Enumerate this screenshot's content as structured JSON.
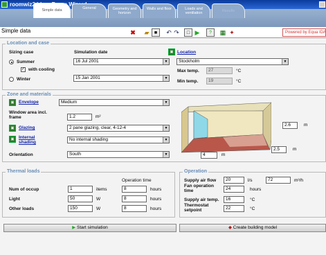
{
  "window": {
    "title": "roomwiz2.idm - Room Wizard"
  },
  "tabs": [
    {
      "label": "Simple data"
    },
    {
      "label": "General"
    },
    {
      "label": "Geometry and horizon"
    },
    {
      "label": "Walls and floor"
    },
    {
      "label": "Loads and ventilation"
    },
    {
      "label": "Results"
    }
  ],
  "toolbar": {
    "page_title": "Simple data",
    "brand": "Powered by Equa IDA"
  },
  "location": {
    "legend": "Location and case",
    "sizing_case_label": "Sizing case",
    "simulation_date_label": "Simulation date",
    "summer_label": "Summer",
    "summer_date": "16 Jul 2001",
    "with_cooling_label": "with cooling",
    "winter_label": "Winter",
    "winter_date": "15 Jan 2001",
    "location_link": "Location",
    "location_value": "Stockholm",
    "max_temp_label": "Max temp.",
    "max_temp_value": "27",
    "min_temp_label": "Min temp.",
    "min_temp_value": "19",
    "temp_unit": "°C"
  },
  "zone": {
    "legend": "Zone and materials",
    "envelope_link": "Envelope",
    "envelope_value": "Medium",
    "window_area_label": "Window area incl. frame",
    "window_area_value": "1.2",
    "window_area_unit": "m²",
    "glazing_link": "Glazing",
    "glazing_value": "2 pane glazing, clear, 4-12-4",
    "shading_link": "Internal shading",
    "shading_value": "No internal shading",
    "orientation_label": "Orientation",
    "orientation_value": "South",
    "room_height": "2.6",
    "room_depth": "2.5",
    "room_width": "4",
    "m": "m"
  },
  "thermal": {
    "legend": "Thermal loads",
    "operation_time_label": "Operation time",
    "occupants_label": "Num of occup",
    "occupants_value": "1",
    "occupants_unit": "items",
    "occupants_hours": "8",
    "light_label": "Light",
    "light_value": "50",
    "light_unit": "W",
    "light_hours": "8",
    "other_label": "Other loads",
    "other_value": "150",
    "other_unit": "W",
    "other_hours": "8",
    "hours": "hours"
  },
  "operation": {
    "legend": "Operation",
    "supply_flow_label": "Supply air flow",
    "supply_flow_ls": "20",
    "unit_ls": "l/s",
    "supply_flow_m3h": "72",
    "unit_m3h": "m³/h",
    "fan_time_label": "Fan operation time",
    "fan_time_value": "24",
    "fan_time_unit": "hours",
    "supply_temp_label": "Supply air temp.",
    "supply_temp_value": "16",
    "setpoint_label": "Thermostat setpoint",
    "setpoint_value": "22",
    "temp_unit": "°C"
  },
  "actions": {
    "start_simulation": "Start simulation",
    "create_model": "Create building model"
  }
}
